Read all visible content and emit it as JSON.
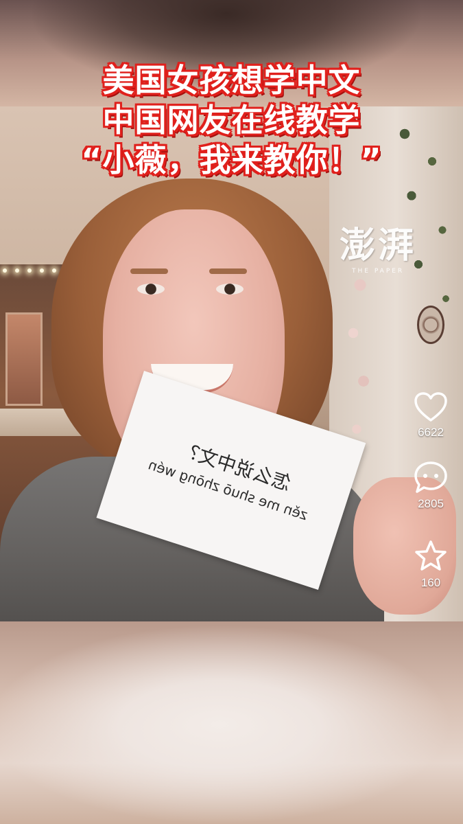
{
  "headline": {
    "line1": "美国女孩想学中文",
    "line2": "中国网友在线教学",
    "line3": "“小薇，我来教你！”"
  },
  "watermark": {
    "mark": "澎湃",
    "sub": "THE PAPER"
  },
  "card": {
    "hanzi": "怎么说中文？",
    "pinyin": "zěn me shuō zhōng wén"
  },
  "actions": {
    "like": {
      "icon": "heart-icon",
      "count": "6622"
    },
    "comment": {
      "icon": "comment-icon",
      "count": "2805"
    },
    "favorite": {
      "icon": "star-icon",
      "count": "160"
    }
  },
  "colors": {
    "headline_text": "#ffffff",
    "headline_outline": "#e0201c"
  }
}
